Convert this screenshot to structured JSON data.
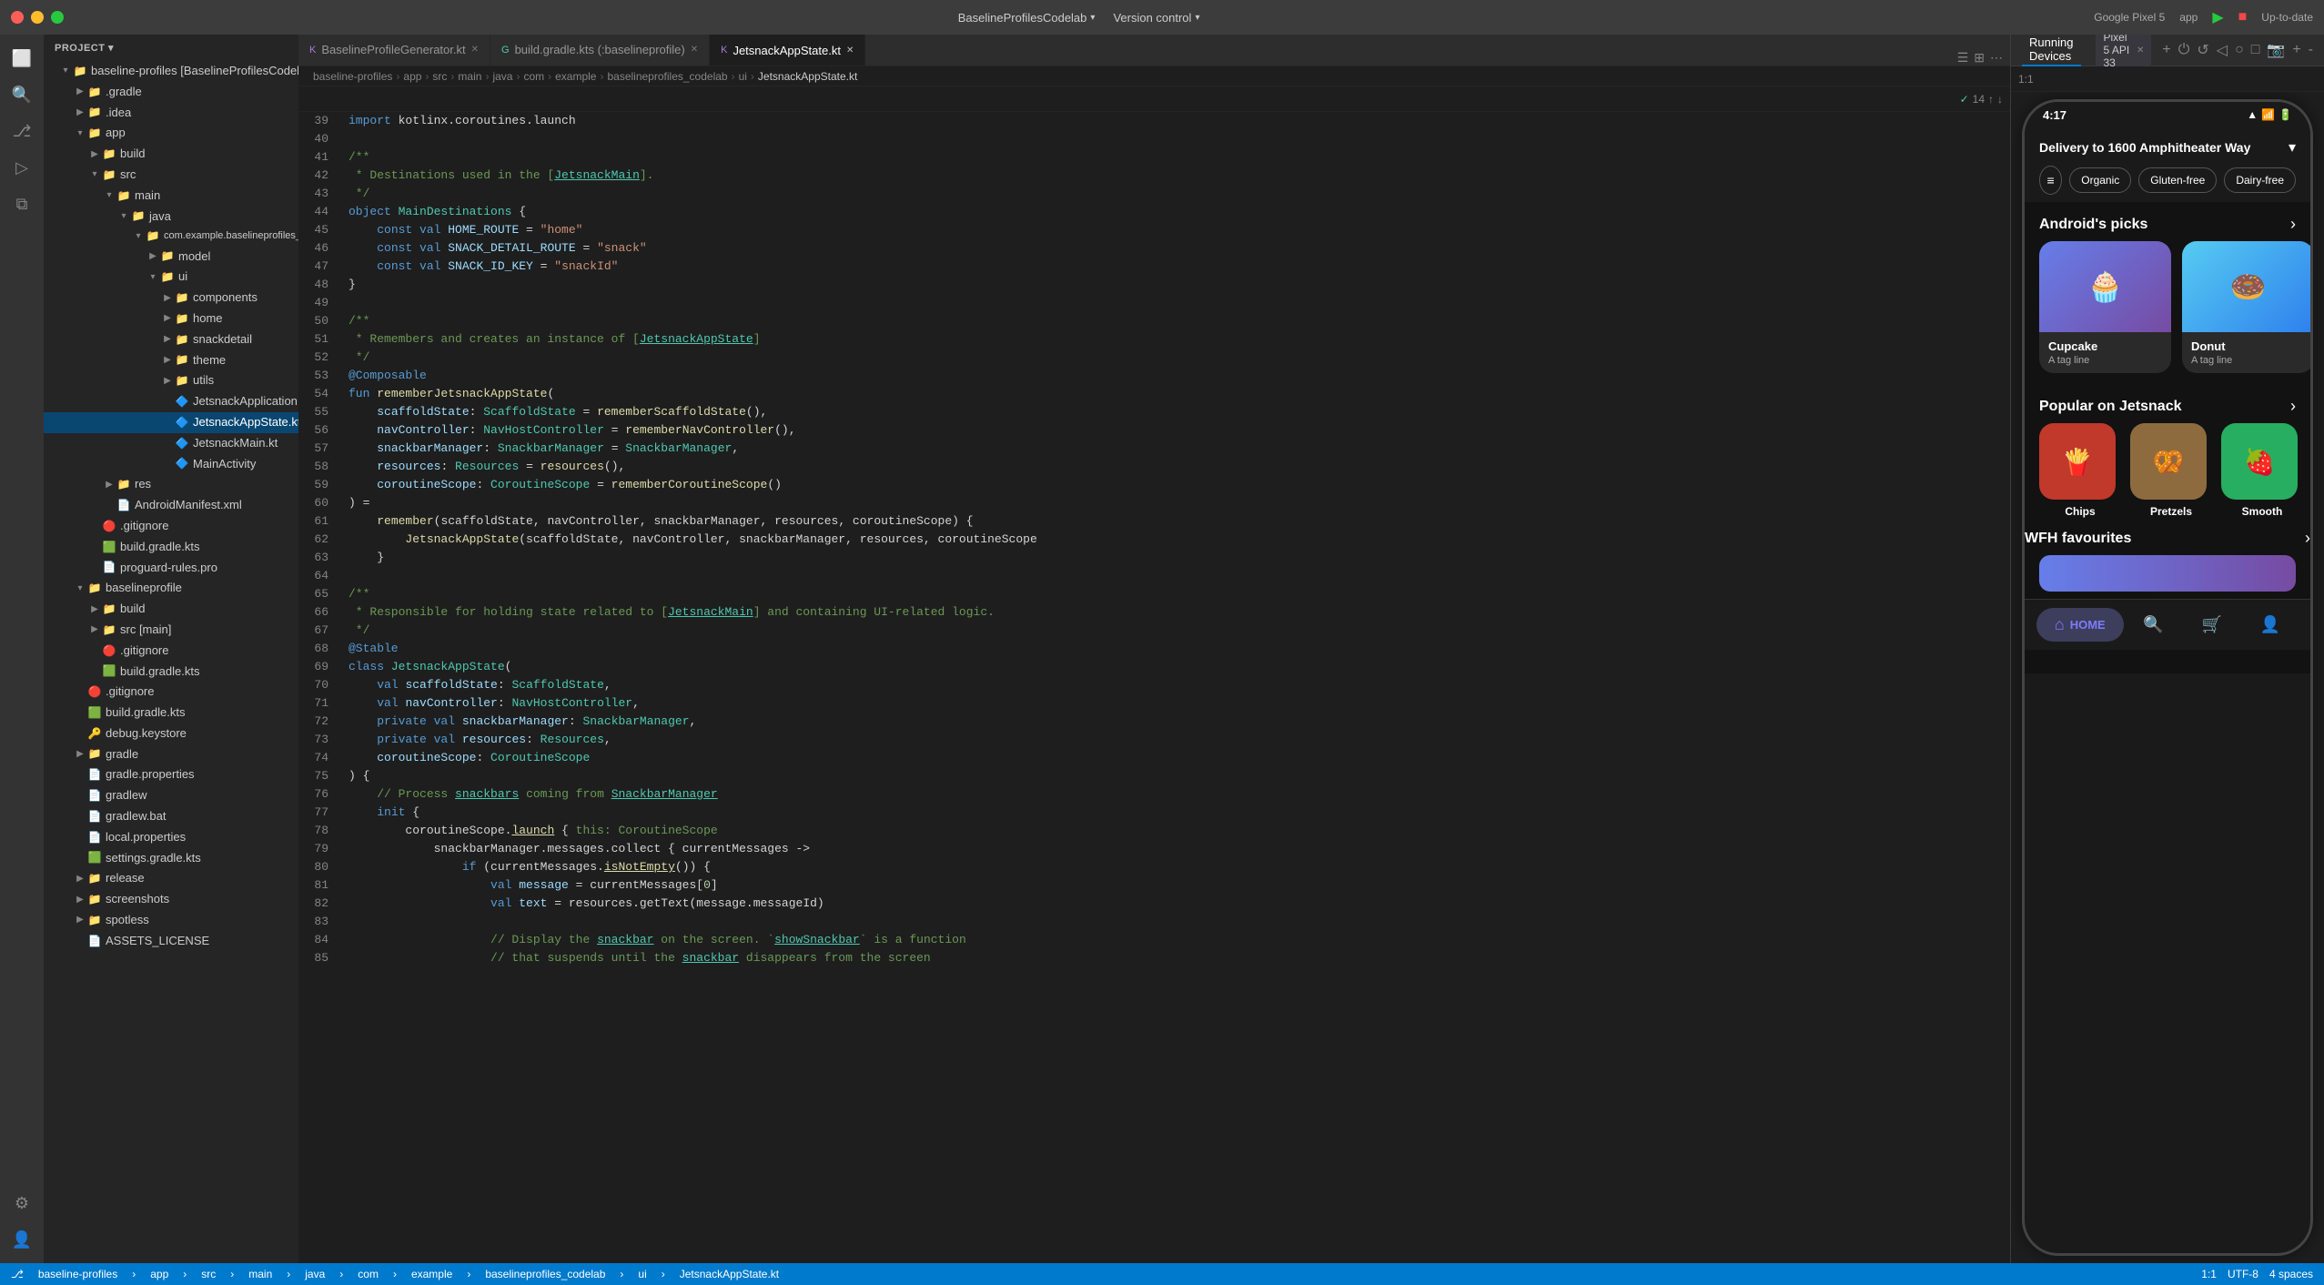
{
  "titleBar": {
    "projectName": "BaselineProfilesCodelab",
    "versionControl": "Version control",
    "deviceName": "Google Pixel 5",
    "appLabel": "app",
    "dropdownArrow": "▾",
    "windowControls": [
      "●",
      "●",
      "●"
    ]
  },
  "fileExplorer": {
    "header": "Project",
    "rootItem": "baseline-profiles [BaselineProfilesCodelab]",
    "items": [
      {
        "label": ".gradle",
        "type": "folder",
        "depth": 1,
        "expanded": false
      },
      {
        "label": ".idea",
        "type": "folder",
        "depth": 1,
        "expanded": false
      },
      {
        "label": "app",
        "type": "folder",
        "depth": 1,
        "expanded": true
      },
      {
        "label": "build",
        "type": "folder",
        "depth": 2,
        "expanded": false
      },
      {
        "label": "src",
        "type": "folder",
        "depth": 2,
        "expanded": true
      },
      {
        "label": "main",
        "type": "folder",
        "depth": 3,
        "expanded": true
      },
      {
        "label": "java",
        "type": "folder",
        "depth": 4,
        "expanded": true
      },
      {
        "label": "com.example.baselineprofiles_codel",
        "type": "folder",
        "depth": 5,
        "expanded": true
      },
      {
        "label": "model",
        "type": "folder",
        "depth": 6,
        "expanded": false
      },
      {
        "label": "ui",
        "type": "folder",
        "depth": 6,
        "expanded": true
      },
      {
        "label": "components",
        "type": "folder",
        "depth": 7,
        "expanded": false
      },
      {
        "label": "home",
        "type": "folder",
        "depth": 7,
        "expanded": false
      },
      {
        "label": "snackdetail",
        "type": "folder",
        "depth": 7,
        "expanded": false
      },
      {
        "label": "theme",
        "type": "folder",
        "depth": 7,
        "expanded": false
      },
      {
        "label": "utils",
        "type": "folder",
        "depth": 7,
        "expanded": false
      },
      {
        "label": "JetsnackApplication",
        "type": "kt",
        "depth": 7
      },
      {
        "label": "JetsnackAppState.kt",
        "type": "kt",
        "depth": 7,
        "active": true
      },
      {
        "label": "JetsnackMain.kt",
        "type": "kt",
        "depth": 7
      },
      {
        "label": "MainActivity",
        "type": "kt",
        "depth": 7
      },
      {
        "label": "res",
        "type": "folder",
        "depth": 3,
        "expanded": false
      },
      {
        "label": "AndroidManifest.xml",
        "type": "xml",
        "depth": 3
      },
      {
        "label": ".gitignore",
        "type": "git",
        "depth": 2
      },
      {
        "label": "build.gradle.kts",
        "type": "gradle",
        "depth": 2
      },
      {
        "label": "proguard-rules.pro",
        "type": "file",
        "depth": 2
      },
      {
        "label": "baselineprofile",
        "type": "folder",
        "depth": 1,
        "expanded": true
      },
      {
        "label": "build",
        "type": "folder",
        "depth": 2,
        "expanded": false
      },
      {
        "label": "src [main]",
        "type": "folder",
        "depth": 2,
        "expanded": false
      },
      {
        "label": ".gitignore",
        "type": "git",
        "depth": 2
      },
      {
        "label": "build.gradle.kts",
        "type": "gradle",
        "depth": 2
      },
      {
        "label": ".gitignore",
        "type": "git",
        "depth": 1
      },
      {
        "label": "build.gradle.kts",
        "type": "gradle",
        "depth": 1
      },
      {
        "label": "debug.keystore",
        "type": "file",
        "depth": 1
      },
      {
        "label": "gradle",
        "type": "folder",
        "depth": 1,
        "expanded": false
      },
      {
        "label": "gradle.properties",
        "type": "props",
        "depth": 1
      },
      {
        "label": "gradlew",
        "type": "file",
        "depth": 1
      },
      {
        "label": "gradlew.bat",
        "type": "file",
        "depth": 1
      },
      {
        "label": "local.properties",
        "type": "props",
        "depth": 1
      },
      {
        "label": "settings.gradle.kts",
        "type": "gradle",
        "depth": 1
      },
      {
        "label": "release",
        "type": "folder",
        "depth": 1,
        "expanded": false
      },
      {
        "label": "screenshots",
        "type": "folder",
        "depth": 1,
        "expanded": false
      },
      {
        "label": "spotless",
        "type": "folder",
        "depth": 1,
        "expanded": false
      },
      {
        "label": "ASSETS_LICENSE",
        "type": "file",
        "depth": 1
      }
    ]
  },
  "tabs": [
    {
      "label": "BaselineProfileGenerator.kt",
      "active": false
    },
    {
      "label": "build.gradle.kts (:baselineprofile)",
      "active": false
    },
    {
      "label": "JetsnackAppState.kt",
      "active": true
    }
  ],
  "editor": {
    "filename": "JetsnackAppState.kt",
    "lines": [
      {
        "num": 39,
        "content": "import kotlinx.coroutines.launch"
      },
      {
        "num": 40,
        "content": ""
      },
      {
        "num": 41,
        "content": "/**"
      },
      {
        "num": 42,
        "content": " * Destinations used in the [JetsnackMain]."
      },
      {
        "num": 43,
        "content": " */"
      },
      {
        "num": 44,
        "content": "object MainDestinations {"
      },
      {
        "num": 45,
        "content": "    const val HOME_ROUTE = \"home\""
      },
      {
        "num": 46,
        "content": "    const val SNACK_DETAIL_ROUTE = \"snack\""
      },
      {
        "num": 47,
        "content": "    const val SNACK_ID_KEY = \"snackId\""
      },
      {
        "num": 48,
        "content": "}"
      },
      {
        "num": 49,
        "content": ""
      },
      {
        "num": 50,
        "content": "/**"
      },
      {
        "num": 51,
        "content": " * Remembers and creates an instance of [JetsnackAppState]"
      },
      {
        "num": 52,
        "content": " */"
      },
      {
        "num": 53,
        "content": "@Composable"
      },
      {
        "num": 54,
        "content": "fun rememberJetsnackAppState("
      },
      {
        "num": 55,
        "content": "    scaffoldState: ScaffoldState = rememberScaffoldState(),"
      },
      {
        "num": 56,
        "content": "    navController: NavHostController = rememberNavController(),"
      },
      {
        "num": 57,
        "content": "    snackbarManager: SnackbarManager = SnackbarManager,"
      },
      {
        "num": 58,
        "content": "    resources: Resources = resources(),"
      },
      {
        "num": 59,
        "content": "    coroutineScope: CoroutineScope = rememberCoroutineScope()"
      },
      {
        "num": 60,
        "content": ") ="
      },
      {
        "num": 61,
        "content": "    remember(scaffoldState, navController, snackbarManager, resources, coroutineScope) {"
      },
      {
        "num": 62,
        "content": "        JetsnackAppState(scaffoldState, navController, snackbarManager, resources, coroutineScope"
      },
      {
        "num": 63,
        "content": "    }"
      },
      {
        "num": 64,
        "content": ""
      },
      {
        "num": 65,
        "content": "/**"
      },
      {
        "num": 66,
        "content": " * Responsible for holding state related to [JetsnackMain] and containing UI-related logic."
      },
      {
        "num": 67,
        "content": " */"
      },
      {
        "num": 68,
        "content": "@Stable"
      },
      {
        "num": 69,
        "content": "class JetsnackAppState("
      },
      {
        "num": 70,
        "content": "    val scaffoldState: ScaffoldState,"
      },
      {
        "num": 71,
        "content": "    val navController: NavHostController,"
      },
      {
        "num": 72,
        "content": "    private val snackbarManager: SnackbarManager,"
      },
      {
        "num": 73,
        "content": "    private val resources: Resources,"
      },
      {
        "num": 74,
        "content": "    coroutineScope: CoroutineScope"
      },
      {
        "num": 75,
        "content": ") {"
      },
      {
        "num": 76,
        "content": "    // Process snackbars coming from SnackbarManager"
      },
      {
        "num": 77,
        "content": "    init {"
      },
      {
        "num": 78,
        "content": "        coroutineScope.launch { this: CoroutineScope"
      },
      {
        "num": 79,
        "content": "            snackbarManager.messages.collect { currentMessages ->"
      },
      {
        "num": 80,
        "content": "                if (currentMessages.isNotEmpty()) {"
      },
      {
        "num": 81,
        "content": "                    val message = currentMessages[0]"
      },
      {
        "num": 82,
        "content": "                    val text = resources.getText(message.messageId)"
      },
      {
        "num": 83,
        "content": ""
      },
      {
        "num": 84,
        "content": "                    // Display the snackbar on the screen. `showSnackbar` is a function"
      },
      {
        "num": 85,
        "content": "                    // that suspends until the snackbar disappears from the screen"
      }
    ]
  },
  "rightPanel": {
    "runningDevicesLabel": "Running Devices",
    "pixelLabel": "Pixel 5 API 33",
    "addButton": "+",
    "phoneTime": "4:17",
    "deliveryAddress": "Delivery to 1600 Amphitheater Way",
    "filters": [
      "Organic",
      "Gluten-free",
      "Dairy-free"
    ],
    "androidPicksTitle": "Android's picks",
    "cupcakeName": "Cupcake",
    "cupcakeTagline": "A tag line",
    "donutName": "Donut",
    "donutTagline": "A tag line",
    "popularTitle": "Popular on Jetsnack",
    "popularItems": [
      {
        "name": "Chips",
        "emoji": "🍟"
      },
      {
        "name": "Pretzels",
        "emoji": "🥨"
      },
      {
        "name": "Smooth",
        "emoji": "🍓"
      }
    ],
    "wfhTitle": "WFH favourites",
    "homeNavLabel": "HOME"
  },
  "statusBar": {
    "breadcrumbs": [
      "baseline-profiles",
      "app",
      "src",
      "main",
      "java",
      "com",
      "example",
      "baselineprofiles_codelab",
      "ui",
      "JetsnackAppState.kt"
    ],
    "lineCol": "1:1",
    "encoding": "UTF-8",
    "indent": "4 spaces",
    "upToDate": "Up-to-date"
  }
}
